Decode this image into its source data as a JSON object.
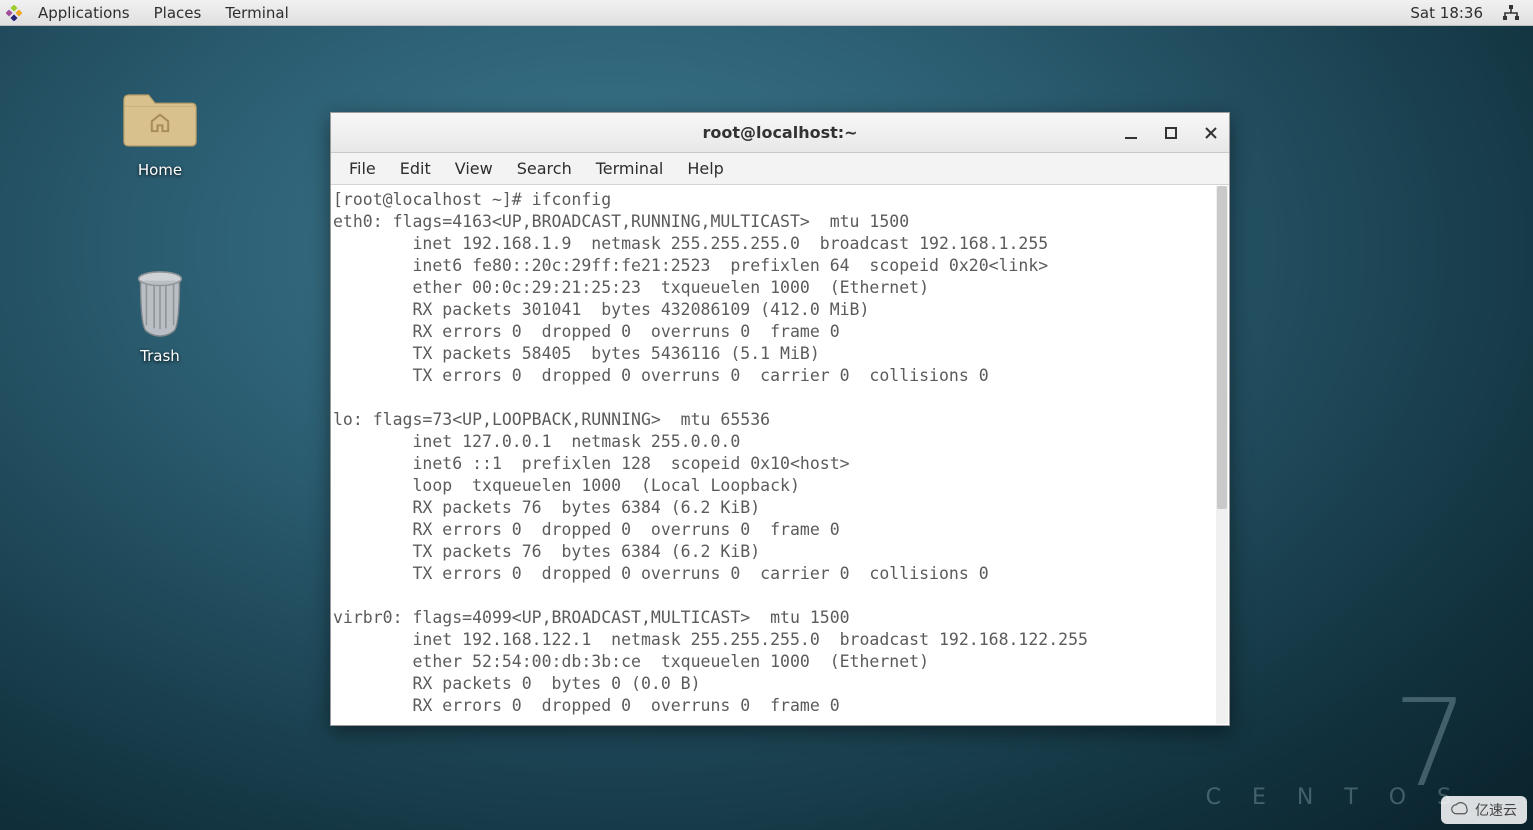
{
  "panel": {
    "menus": [
      "Applications",
      "Places",
      "Terminal"
    ],
    "clock": "Sat 18:36"
  },
  "desktop": {
    "icons": [
      {
        "label": "Home"
      },
      {
        "label": "Trash"
      }
    ]
  },
  "window": {
    "title": "root@localhost:~",
    "menus": [
      "File",
      "Edit",
      "View",
      "Search",
      "Terminal",
      "Help"
    ],
    "terminal_output": "[root@localhost ~]# ifconfig\neth0: flags=4163<UP,BROADCAST,RUNNING,MULTICAST>  mtu 1500\n        inet 192.168.1.9  netmask 255.255.255.0  broadcast 192.168.1.255\n        inet6 fe80::20c:29ff:fe21:2523  prefixlen 64  scopeid 0x20<link>\n        ether 00:0c:29:21:25:23  txqueuelen 1000  (Ethernet)\n        RX packets 301041  bytes 432086109 (412.0 MiB)\n        RX errors 0  dropped 0  overruns 0  frame 0\n        TX packets 58405  bytes 5436116 (5.1 MiB)\n        TX errors 0  dropped 0 overruns 0  carrier 0  collisions 0\n\nlo: flags=73<UP,LOOPBACK,RUNNING>  mtu 65536\n        inet 127.0.0.1  netmask 255.0.0.0\n        inet6 ::1  prefixlen 128  scopeid 0x10<host>\n        loop  txqueuelen 1000  (Local Loopback)\n        RX packets 76  bytes 6384 (6.2 KiB)\n        RX errors 0  dropped 0  overruns 0  frame 0\n        TX packets 76  bytes 6384 (6.2 KiB)\n        TX errors 0  dropped 0 overruns 0  carrier 0  collisions 0\n\nvirbr0: flags=4099<UP,BROADCAST,MULTICAST>  mtu 1500\n        inet 192.168.122.1  netmask 255.255.255.0  broadcast 192.168.122.255\n        ether 52:54:00:db:3b:ce  txqueuelen 1000  (Ethernet)\n        RX packets 0  bytes 0 (0.0 B)\n        RX errors 0  dropped 0  overruns 0  frame 0"
  },
  "brand": {
    "version": "7",
    "name": "C E N T O S"
  },
  "watermark": "亿速云"
}
